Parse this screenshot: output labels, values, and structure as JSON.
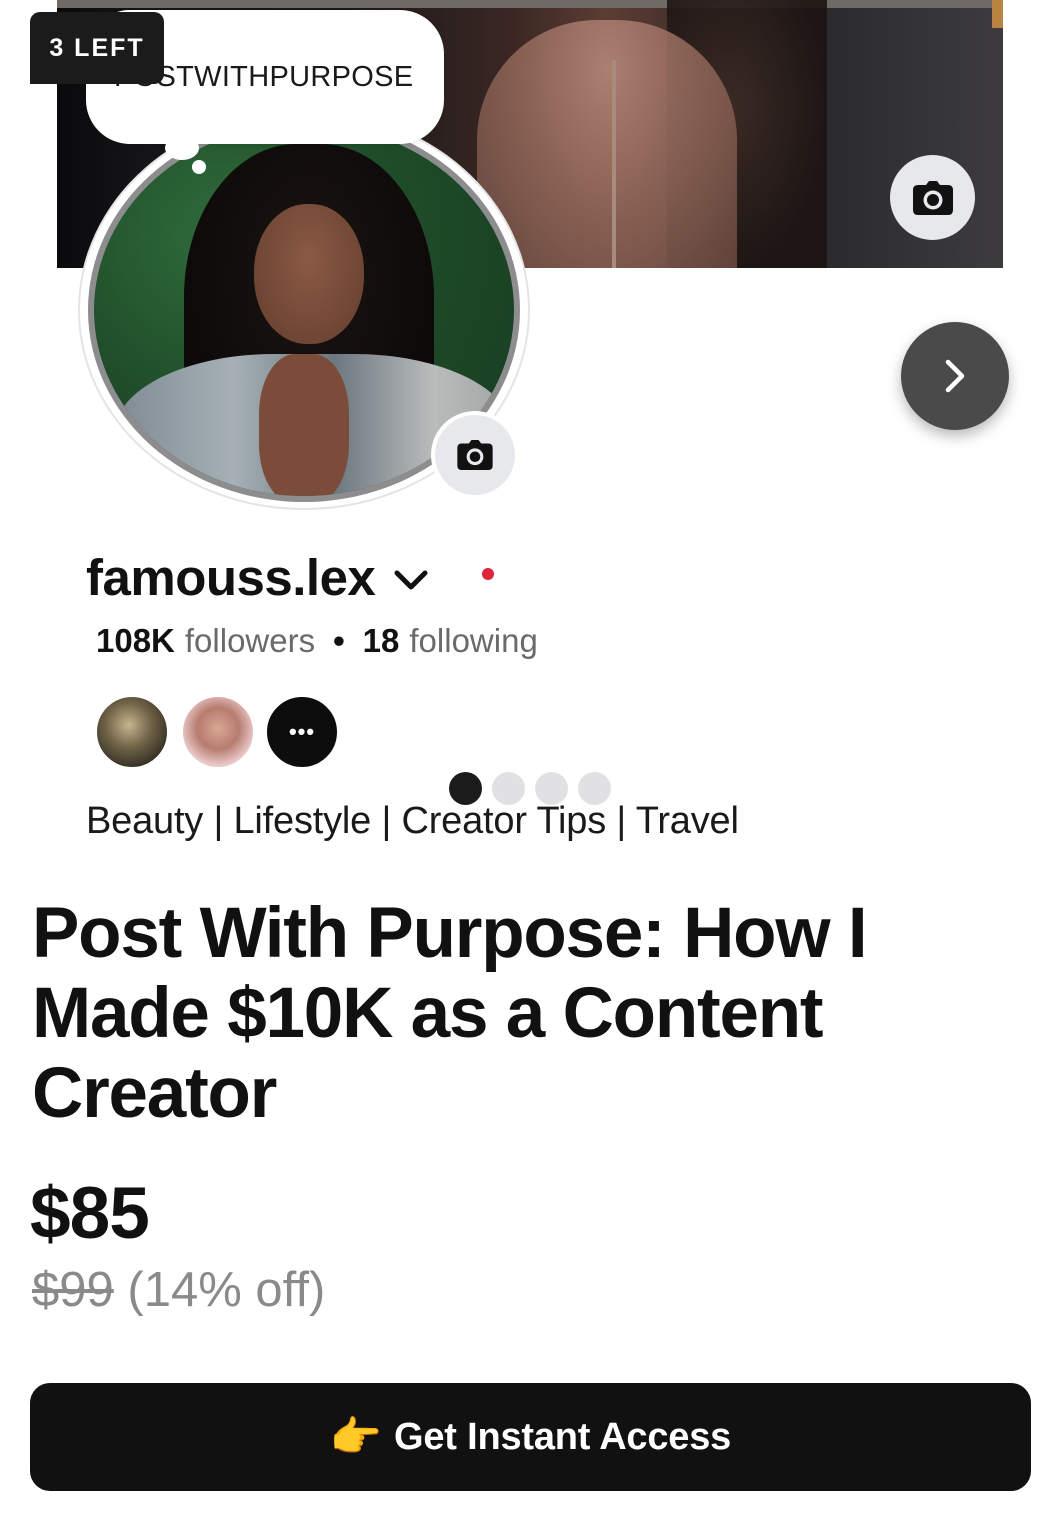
{
  "badge": {
    "text": "3 LEFT"
  },
  "profile_tag": {
    "text": "POSTWITHPURPOSE"
  },
  "profile": {
    "username": "famouss.lex",
    "followers_count": "108K",
    "followers_label": "followers",
    "following_count": "18",
    "following_label": "following",
    "bio": "Beauty | Lifestyle | Creator Tips | Travel",
    "more_followers_label": "•••"
  },
  "carousel": {
    "pages": 4,
    "active_index": 0
  },
  "product": {
    "title": "Post With Purpose: How I Made $10K as a Content Creator",
    "price": "$85",
    "original_price": "$99",
    "discount": "(14% off)"
  },
  "cta": {
    "emoji": "👉",
    "label": "Get Instant Access"
  },
  "icons": {
    "cover_camera": "camera-icon",
    "avatar_camera": "camera-icon",
    "next": "chevron-right-icon",
    "username_dropdown": "chevron-down-icon"
  },
  "colors": {
    "cta_bg": "#111111",
    "notification_dot": "#e0223a",
    "pager_active": "#1b1b1b",
    "pager_inactive": "#e1e1e3"
  }
}
